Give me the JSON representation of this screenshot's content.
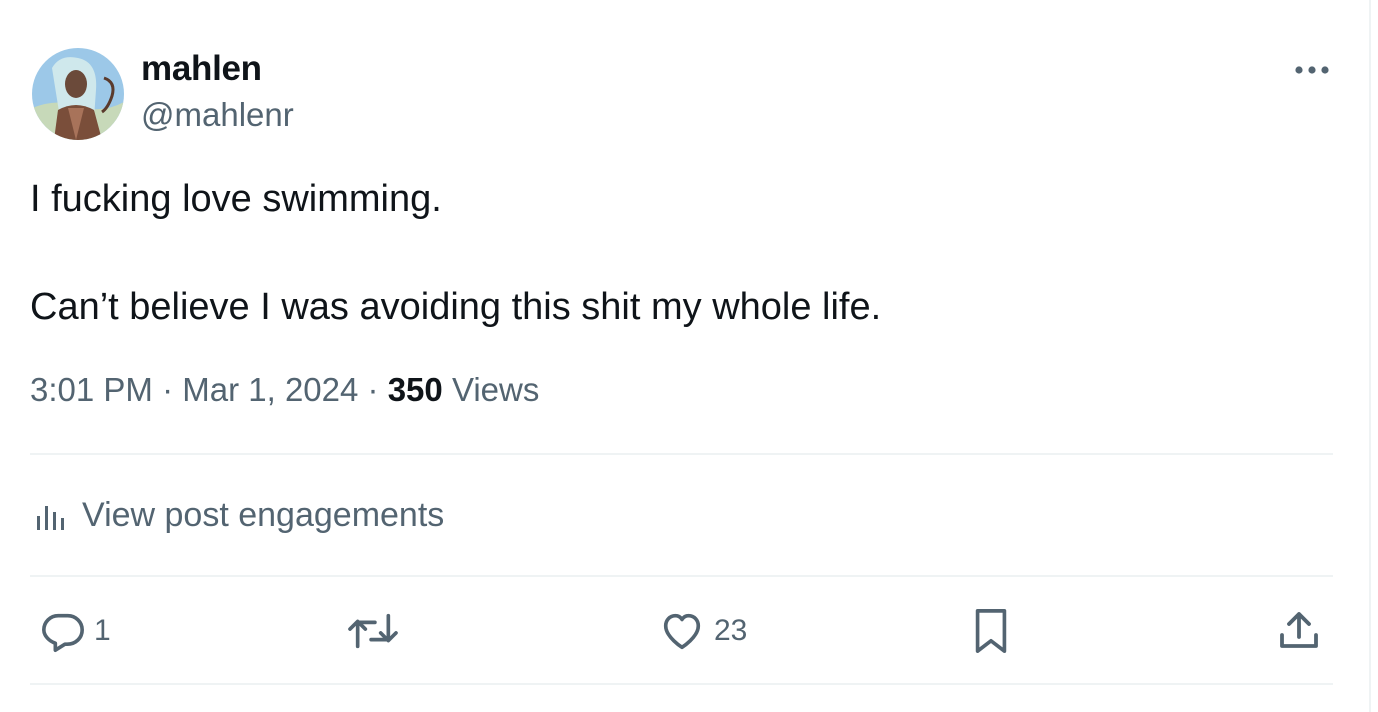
{
  "tweet": {
    "author": {
      "name": "mahlen",
      "handle": "@mahlenr"
    },
    "text": "I fucking love swimming.\n\nCan’t believe I was avoiding this shit my whole life.",
    "time": "3:01 PM",
    "date": "Mar 1, 2024",
    "separator": "·",
    "views_count": "350",
    "views_label": "Views",
    "engagements_label": "View post engagements"
  },
  "actions": {
    "reply_count": "1",
    "like_count": "23"
  },
  "icons": {
    "more": "more-icon",
    "analytics": "bar-chart-icon",
    "reply": "reply-icon",
    "retweet": "retweet-icon",
    "like": "heart-icon",
    "bookmark": "bookmark-icon",
    "share": "share-icon"
  },
  "colors": {
    "text_primary": "#0f1419",
    "text_secondary": "#536471",
    "divider": "#eff3f4"
  }
}
